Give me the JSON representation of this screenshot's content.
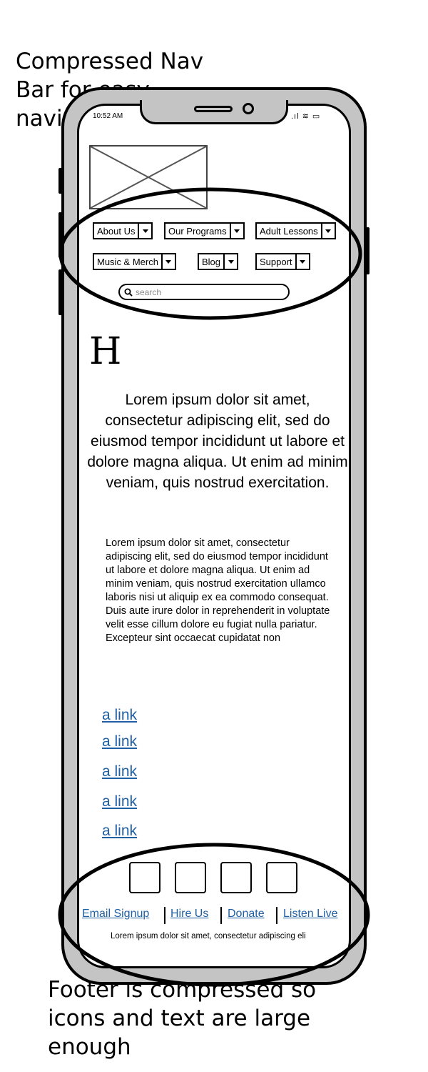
{
  "annotations": {
    "nav_note": "Compressed Nav\nBar for easy\nnavigation",
    "footer_note": "Footer is compressed so\nicons and text are large\nenough"
  },
  "status_bar": {
    "time": "10:52 AM",
    "icons": [
      "signal-icon",
      "wifi-icon",
      "battery-icon"
    ]
  },
  "nav": {
    "items": [
      {
        "label": "About Us"
      },
      {
        "label": "Our Programs"
      },
      {
        "label": "Adult Lessons"
      },
      {
        "label": "Music & Merch"
      },
      {
        "label": "Blog"
      },
      {
        "label": "Support"
      }
    ],
    "search_placeholder": "search"
  },
  "content": {
    "heading": "H",
    "lead": "Lorem ipsum dolor sit amet, consectetur adipiscing elit, sed do eiusmod tempor incididunt ut labore et dolore magna aliqua. Ut enim ad minim veniam, quis nostrud exercitation.",
    "body": "Lorem ipsum dolor sit amet, consectetur adipiscing elit, sed do eiusmod tempor incididunt ut labore et dolore magna aliqua. Ut enim ad minim veniam, quis nostrud exercitation ullamco laboris nisi ut aliquip ex ea commodo consequat. Duis aute irure dolor in reprehenderit in voluptate velit esse cillum dolore eu fugiat nulla pariatur. Excepteur sint occaecat cupidatat non",
    "links": [
      "a link",
      "a link",
      "a link",
      "a link",
      "a link"
    ]
  },
  "footer": {
    "links": [
      "Email Signup",
      "Hire Us",
      "Donate",
      "Listen Live"
    ],
    "text": "Lorem ipsum dolor sit amet, consectetur adipiscing eli"
  },
  "colors": {
    "link": "#1f5fa3",
    "frame": "#c4c4c4"
  }
}
